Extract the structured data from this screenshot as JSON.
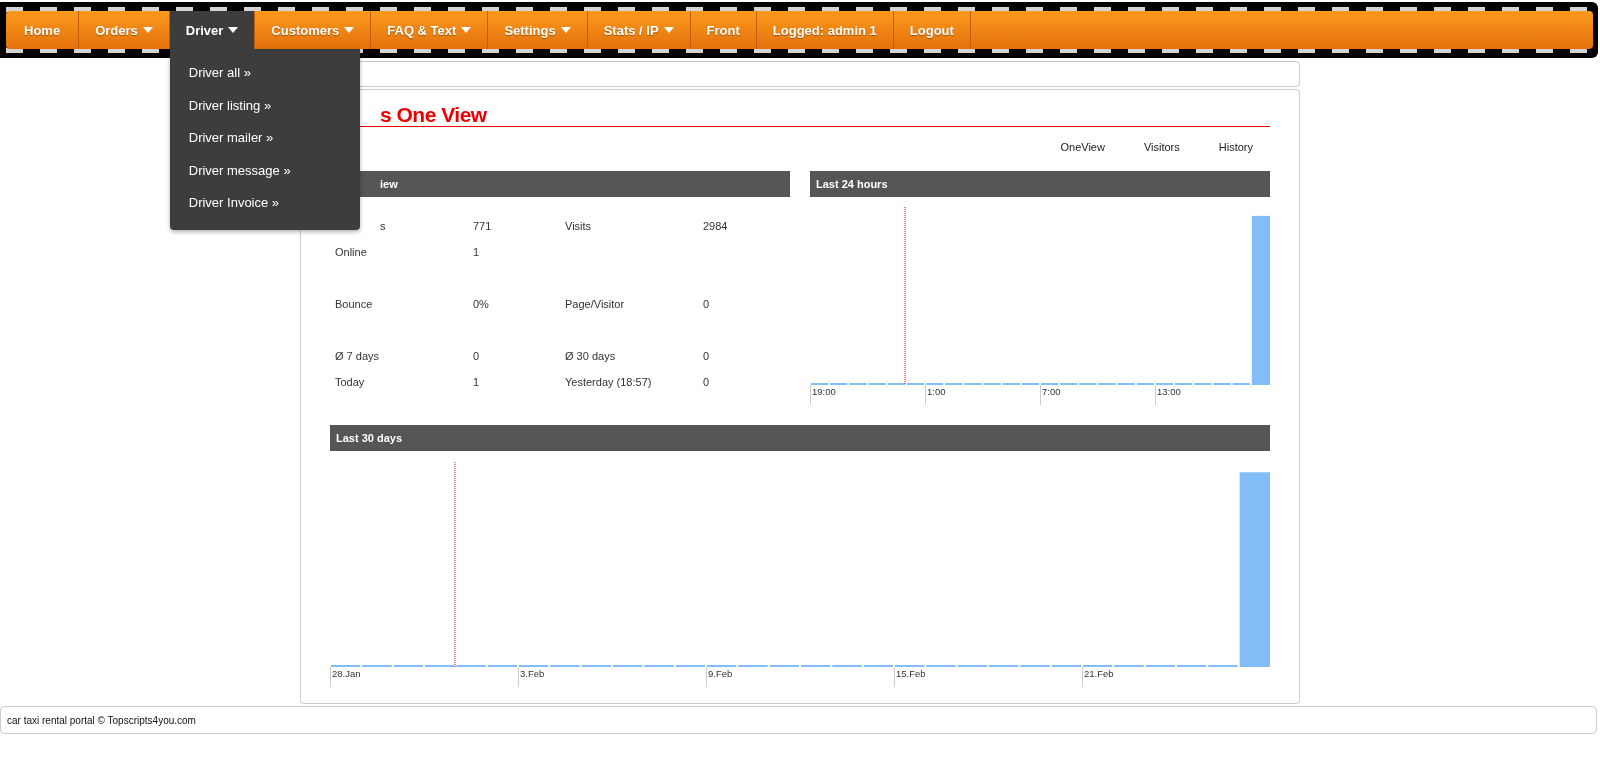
{
  "nav": {
    "items": [
      {
        "label": "Home",
        "dropdown": false,
        "selected": false
      },
      {
        "label": "Orders",
        "dropdown": true,
        "selected": false
      },
      {
        "label": "Driver",
        "dropdown": true,
        "selected": true,
        "menu": [
          "Driver all »",
          "Driver listing »",
          "Driver mailer »",
          "Driver message »",
          "Driver Invoice »"
        ]
      },
      {
        "label": "Customers",
        "dropdown": true,
        "selected": false
      },
      {
        "label": "FAQ & Text",
        "dropdown": true,
        "selected": false
      },
      {
        "label": "Settings",
        "dropdown": true,
        "selected": false
      },
      {
        "label": "Stats / IP",
        "dropdown": true,
        "selected": false
      },
      {
        "label": "Front",
        "dropdown": false,
        "selected": false
      },
      {
        "label": "Logged: admin 1",
        "dropdown": false,
        "selected": false
      },
      {
        "label": "Logout",
        "dropdown": false,
        "selected": false
      }
    ]
  },
  "page": {
    "title": "s One View",
    "links": [
      "OneView",
      "Visitors",
      "History"
    ],
    "overview": {
      "header": "iew",
      "groups": [
        [
          {
            "cells": [
              "s",
              "771",
              "Visits",
              "2984"
            ]
          },
          {
            "cells": [
              "Online",
              "1"
            ]
          }
        ],
        [
          {
            "cells": [
              "Bounce",
              "0%",
              "Page/Visitor",
              "0"
            ]
          }
        ],
        [
          {
            "cells": [
              "Ø 7 days",
              "0",
              "Ø 30 days",
              "0"
            ]
          },
          {
            "cells": [
              "Today",
              "1",
              "Yesterday (18:57)",
              "0"
            ]
          }
        ]
      ]
    },
    "last24": {
      "header": "Last 24 hours",
      "labels": [
        "19:00",
        "1:00",
        "7:00",
        "13:00"
      ]
    },
    "last30": {
      "header": "Last 30 days",
      "labels": [
        "28.Jan",
        "3.Feb",
        "9.Feb",
        "15.Feb",
        "21.Feb"
      ]
    }
  },
  "footer": "car taxi rental portal © Topscripts4you.com"
}
